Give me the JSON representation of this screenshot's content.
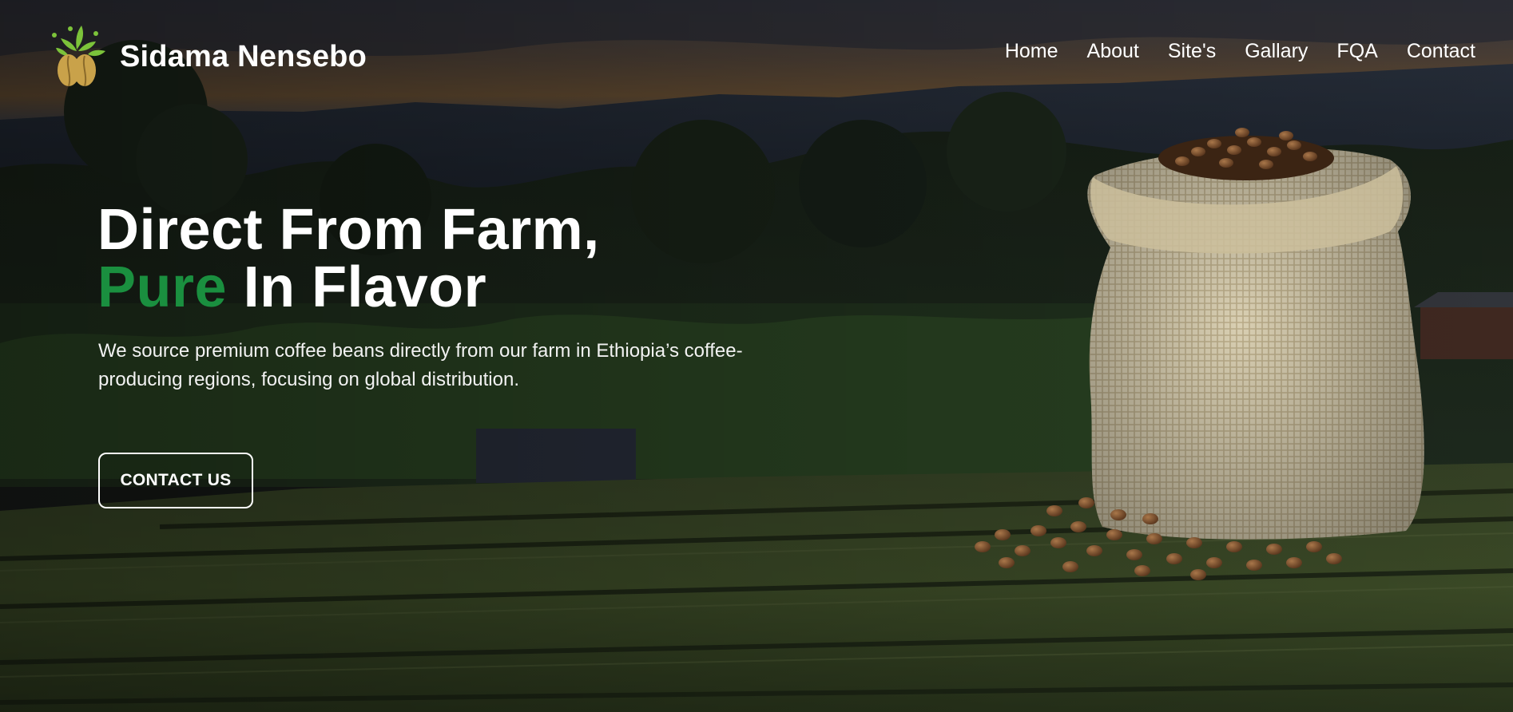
{
  "brand": {
    "name": "Sidama Nensebo",
    "logo_icon": "coffee-plant-logo-icon"
  },
  "nav": {
    "items": [
      {
        "label": "Home"
      },
      {
        "label": "About"
      },
      {
        "label": "Site's"
      },
      {
        "label": "Gallary"
      },
      {
        "label": "FQA"
      },
      {
        "label": "Contact"
      }
    ]
  },
  "hero": {
    "headline_line1": "Direct From Farm,",
    "headline_accent": "Pure",
    "headline_rest": " In Flavor",
    "description": "We source premium coffee beans directly from our farm in Ethiopia’s coffee-producing regions, focusing on global distribution.",
    "cta_label": "CONTACT US",
    "image_icon": "coffee-sack-icon",
    "background_image": "coffee-farm-drying-beds-image"
  },
  "colors": {
    "accent_green": "#1a8f3f",
    "text_white": "#ffffff",
    "logo_gold": "#c9a24a",
    "logo_green": "#7cc33a"
  }
}
